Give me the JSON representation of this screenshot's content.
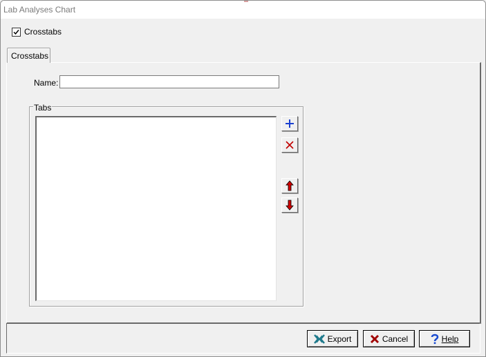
{
  "window": {
    "title": "Lab Analyses Chart"
  },
  "crosstabs_toggle": {
    "label": "Crosstabs",
    "checked": true
  },
  "tabs": [
    {
      "label": "Crosstabs",
      "active": true
    }
  ],
  "form": {
    "name_label": "Name:",
    "name_value": ""
  },
  "tabs_group": {
    "label": "Tabs",
    "items": [],
    "actions": [
      {
        "name": "add",
        "icon": "plus-icon"
      },
      {
        "name": "delete",
        "icon": "close-icon"
      },
      {
        "name": "move-up",
        "icon": "arrow-up-icon"
      },
      {
        "name": "move-down",
        "icon": "arrow-down-icon"
      }
    ]
  },
  "footer": {
    "export_label": "Export",
    "cancel_label": "Cancel",
    "help_label": "Help"
  },
  "colors": {
    "add_blue": "#1a3fd0",
    "close_red": "#c00000",
    "arrow_red": "#d00000",
    "export_teal": "#1f7a8c",
    "help_blue": "#1a4bd0"
  }
}
